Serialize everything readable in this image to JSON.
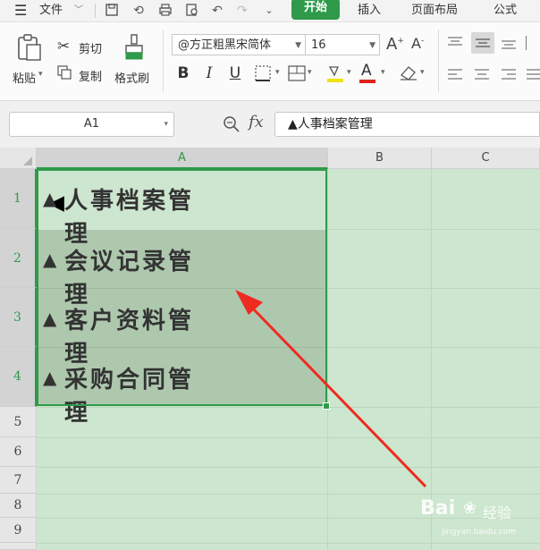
{
  "menubar": {
    "file_label": "文件",
    "start_tab": "开始",
    "insert_tab": "插入",
    "layout_tab": "页面布局",
    "formula_tab": "公式"
  },
  "ribbon": {
    "paste_label": "粘贴",
    "cut_label": "剪切",
    "copy_label": "复制",
    "format_painter_label": "格式刷",
    "font_name": "@方正粗黑宋简体",
    "font_size": "16",
    "bold": "B",
    "italic": "I",
    "underline": "U"
  },
  "formula_bar": {
    "name_box": "A1",
    "fx_label": "fx",
    "content": "▲人事档案管理"
  },
  "grid": {
    "columns": [
      "A",
      "B",
      "C"
    ],
    "rows": [
      "1",
      "2",
      "3",
      "4",
      "5",
      "6",
      "7",
      "8",
      "9"
    ],
    "cells": [
      {
        "tri": "▲",
        "text": "人事档案管理"
      },
      {
        "tri": "▲",
        "text": "会议记录管理"
      },
      {
        "tri": "▲",
        "text": "客户资料管理"
      },
      {
        "tri": "▲",
        "text": "采购合同管理"
      }
    ]
  },
  "watermark": {
    "brand": "Bai",
    "brand_suffix": "经验",
    "url": "jingyan.baidu.com"
  },
  "colors": {
    "accent_green": "#2f9a4a",
    "sheet_bg": "#cde6cf",
    "selection_bg": "#aec8ae",
    "arrow_red": "#ee2b20"
  }
}
